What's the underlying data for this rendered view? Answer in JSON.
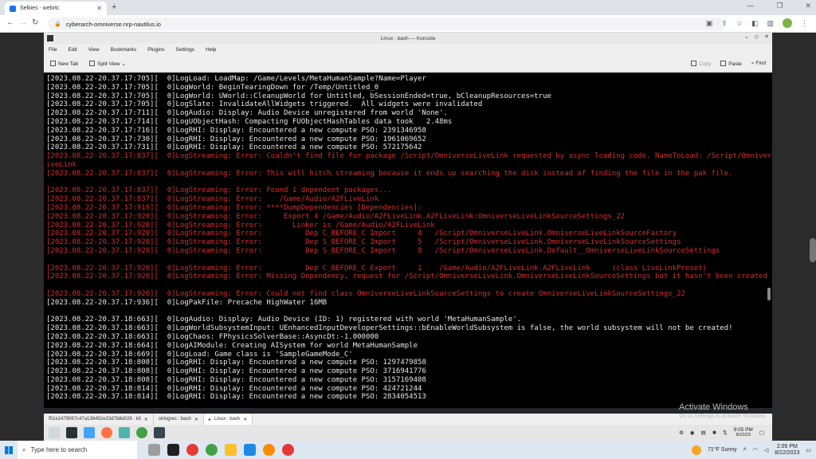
{
  "browser": {
    "tab_title": "Selkies - webrtc",
    "url": "cyberarch-omniverse.nrp-nautilus.io"
  },
  "konsole": {
    "title": "Linux : bash — Konsole",
    "menu": [
      "File",
      "Edit",
      "View",
      "Bookmarks",
      "Plugins",
      "Settings",
      "Help"
    ],
    "toolbar": {
      "new_tab": "New Tab",
      "split_view": "Split View",
      "copy": "Copy",
      "paste": "Paste",
      "find": "Find"
    },
    "lines": [
      {
        "t": "[2023.08.22-20.37.17:705][  0]LogLoad: LoadMap: /Game/Levels/MetaHumanSample?Name=Player",
        "err": false
      },
      {
        "t": "[2023.08.22-20.37.17:705][  0]LogWorld: BeginTearingDown for /Temp/Untitled_0",
        "err": false
      },
      {
        "t": "[2023.08.22-20.37.17:705][  0]LogWorld: UWorld::CleanupWorld for Untitled, bSessionEnded=true, bCleanupResources=true",
        "err": false
      },
      {
        "t": "[2023.08.22-20.37.17:705][  0]LogSlate: InvalidateAllWidgets triggered.  All widgets were invalidated",
        "err": false
      },
      {
        "t": "[2023.08.22-20.37.17:711][  0]LogAudio: Display: Audio Device unregistered from world 'None'.",
        "err": false
      },
      {
        "t": "[2023.08.22-20.37.17:714][  0]LogUObjectHash: Compacting FUObjectHashTables data took   2.48ms",
        "err": false
      },
      {
        "t": "[2023.08.22-20.37.17:716][  0]LogRHI: Display: Encountered a new compute PSO: 2391346958",
        "err": false
      },
      {
        "t": "[2023.08.22-20.37.17:730][  0]LogRHI: Display: Encountered a new compute PSO: 1961069652",
        "err": false
      },
      {
        "t": "[2023.08.22-20.37.17:731][  0]LogRHI: Display: Encountered a new compute PSO: 572175642",
        "err": false
      },
      {
        "t": "[2023.08.22-20.37.17:837][  0]LogStreaming: Error: Couldn't find file for package /Script/OmniverseLiveLink requested by async loading code. NameToLoad: /Script/OmniverseL",
        "err": true
      },
      {
        "t": "iveLink",
        "err": true
      },
      {
        "t": "[2023.08.22-20.37.17:837][  0]LogStreaming: Error: This will hitch streaming because it ends up searching the disk instead of finding the file in the pak file.",
        "err": true
      },
      {
        "t": "",
        "err": false
      },
      {
        "t": "[2023.08.22-20.37.17:837][  0]LogStreaming: Error: Found 1 dependent packages...",
        "err": true
      },
      {
        "t": "[2023.08.22-20.37.17:837][  0]LogStreaming: Error:    /Game/Audio/A2FLiveLink",
        "err": true
      },
      {
        "t": "[2023.08.22-20.37.17:919][  0]LogStreaming: Error: ****DumpDependencies [Dependencies]:",
        "err": true
      },
      {
        "t": "[2023.08.22-20.37.17:920][  0]LogStreaming: Error:     Export 4 /Game/Audio/A2FLiveLink.A2FLiveLink:OmniverseLiveLinkSourceSettings_22",
        "err": true
      },
      {
        "t": "[2023.08.22-20.37.17:920][  0]LogStreaming: Error:       Linker is /Game/Audio/A2FLiveLink",
        "err": true
      },
      {
        "t": "[2023.08.22-20.37.17:920][  0]LogStreaming: Error:          Dep C_BEFORE_C Import     4   /Script/OmniverseLiveLink.OmniverseLiveLinkSourceFactory",
        "err": true
      },
      {
        "t": "[2023.08.22-20.37.17:920][  0]LogStreaming: Error:          Dep S_BEFORE_C Import     5   /Script/OmniverseLiveLink.OmniverseLiveLinkSourceSettings",
        "err": true
      },
      {
        "t": "[2023.08.22-20.37.17:920][  0]LogStreaming: Error:          Dep S_BEFORE_C Import     9   /Script/OmniverseLiveLink.Default__OmniverseLiveLinkSourceSettings",
        "err": true
      },
      {
        "t": "",
        "err": false
      },
      {
        "t": "[2023.08.22-20.37.17:920][  0]LogStreaming: Error:          Dep C_BEFORE_C Export     1    /Game/Audio/A2FLiveLink.A2FLiveLink     (class LiveLinkPreset)",
        "err": true
      },
      {
        "t": "[2023.08.22-20.37.17:920][  0]LogStreaming: Error: Missing Dependency, request for /Script/OmniverseLiveLink.OmniverseLiveLinkSourceSettings but it hasn't been created yet",
        "err": true
      },
      {
        "t": "",
        "err": false
      },
      {
        "t": "[2023.08.22-20.37.17:920][  0]LogStreaming: Error: Could not find class OmniverseLiveLinkSourceSettings to create OmniverseLiveLinkSourceSettings_22",
        "err": true
      },
      {
        "t": "[2023.08.22-20.37.17:936][  0]LogPakFile: Precache HighWater 16MB",
        "err": false
      },
      {
        "t": "",
        "err": false
      },
      {
        "t": "[2023.08.22-20.37.18:663][  0]LogAudio: Display: Audio Device (ID: 1) registered with world 'MetaHumanSample'.",
        "err": false
      },
      {
        "t": "[2023.08.22-20.37.18:663][  0]LogWorldSubsystemInput: UEnhancedInputDeveloperSettings::bEnableWorldSubsystem is false, the world subsystem will not be created!",
        "err": false
      },
      {
        "t": "[2023.08.22-20.37.18:663][  0]LogChaos: FPhysicsSolverBase::AsyncDt:-1.000000",
        "err": false
      },
      {
        "t": "[2023.08.22-20.37.18:664][  0]LogAIModule: Creating AISystem for world MetaHumanSample",
        "err": false
      },
      {
        "t": "[2023.08.22-20.37.18:669][  0]LogLoad: Game class is 'SampleGameMode_C'",
        "err": false
      },
      {
        "t": "[2023.08.22-20.37.18:808][  0]LogRHI: Display: Encountered a new compute PSO: 1297479858",
        "err": false
      },
      {
        "t": "[2023.08.22-20.37.18:808][  0]LogRHI: Display: Encountered a new compute PSO: 3716941776",
        "err": false
      },
      {
        "t": "[2023.08.22-20.37.18:808][  0]LogRHI: Display: Encountered a new compute PSO: 3157169408",
        "err": false
      },
      {
        "t": "[2023.08.22-20.37.18:814][  0]LogRHI: Display: Encountered a new compute PSO: 424721244",
        "err": false
      },
      {
        "t": "[2023.08.22-20.37.18:814][  0]LogRHI: Display: Encountered a new compute PSO: 2834054513",
        "err": false
      }
    ],
    "tabs": [
      {
        "label": "f51e1479067c47a136492e33d7b8d026 : kit",
        "active": false
      },
      {
        "label": "stringrec : bash",
        "active": false
      },
      {
        "label": "Linux : bash",
        "active": true
      }
    ]
  },
  "remote_panel": {
    "time": "9:05 PM",
    "date": "8/22/23"
  },
  "watermark": {
    "title": "Activate Windows",
    "subtitle": "Go to Settings to activate Windows."
  },
  "taskbar": {
    "search_placeholder": "Type here to search",
    "weather": "71°F  Sunny",
    "time": "2:05 PM",
    "date": "8/22/2023"
  },
  "colors": {
    "error_text": "#d32f2f",
    "normal_text": "#e8e8e8",
    "terminal_bg": "#000000"
  }
}
